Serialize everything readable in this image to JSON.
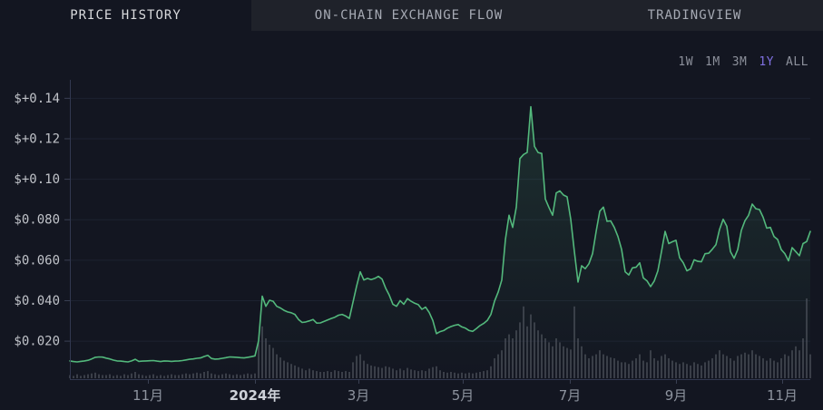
{
  "tabs": [
    {
      "label": "PRICE HISTORY",
      "active": true
    },
    {
      "label": "ON-CHAIN EXCHANGE FLOW",
      "active": false
    },
    {
      "label": "TRADINGVIEW",
      "active": false
    }
  ],
  "ranges": [
    {
      "label": "1W",
      "active": false
    },
    {
      "label": "1M",
      "active": false
    },
    {
      "label": "3M",
      "active": false
    },
    {
      "label": "1Y",
      "active": true
    },
    {
      "label": "ALL",
      "active": false
    }
  ],
  "colors": {
    "background": "#131621",
    "tabbar_bg": "#1f222a",
    "line": "#53b87c",
    "area_top": "rgba(83,184,124,0.16)",
    "area_bottom": "rgba(83,184,124,0.0)",
    "grid": "#1d2231",
    "axis": "#323850",
    "tick": "#3a4053",
    "y_label": "#c0c3c9",
    "x_label": "#8d939e",
    "x_label_bold": "#ced2d9",
    "volume": "#4a4f58",
    "range_active": "#7f70e0"
  },
  "chart_data": {
    "type": "line",
    "title": "Price history, 1 year",
    "currency": "USD",
    "grid": true,
    "y_axis_range": [
      0.001,
      0.148
    ],
    "y_ticks": [
      {
        "label": "$+0.14",
        "v": 0.14
      },
      {
        "label": "$+0.12",
        "v": 0.12
      },
      {
        "label": "$+0.10",
        "v": 0.1
      },
      {
        "label": "$0.080",
        "v": 0.08
      },
      {
        "label": "$0.060",
        "v": 0.06
      },
      {
        "label": "$0.040",
        "v": 0.04
      },
      {
        "label": "$0.020",
        "v": 0.02
      }
    ],
    "x_ticks": [
      {
        "label": "11月",
        "f": 0.1054,
        "bold": false
      },
      {
        "label": "2024年",
        "f": 0.25,
        "bold": true
      },
      {
        "label": "3月",
        "f": 0.3897,
        "bold": false
      },
      {
        "label": "5月",
        "f": 0.5306,
        "bold": false
      },
      {
        "label": "7月",
        "f": 0.6752,
        "bold": false
      },
      {
        "label": "9月",
        "f": 0.8186,
        "bold": false
      },
      {
        "label": "11月",
        "f": 0.962,
        "bold": false
      }
    ],
    "series": [
      {
        "name": "price",
        "values": [
          0.01,
          0.0097,
          0.0095,
          0.0098,
          0.01,
          0.0103,
          0.011,
          0.0118,
          0.012,
          0.0119,
          0.0114,
          0.011,
          0.0104,
          0.01,
          0.0099,
          0.0097,
          0.0095,
          0.01,
          0.0108,
          0.0098,
          0.0099,
          0.01,
          0.0101,
          0.0102,
          0.0099,
          0.0097,
          0.01,
          0.0099,
          0.0098,
          0.0099,
          0.01,
          0.0102,
          0.0105,
          0.0108,
          0.011,
          0.0113,
          0.0115,
          0.0122,
          0.0128,
          0.0112,
          0.0109,
          0.011,
          0.0113,
          0.0116,
          0.012,
          0.0119,
          0.0118,
          0.0116,
          0.0115,
          0.0118,
          0.0121,
          0.0125,
          0.02,
          0.042,
          0.037,
          0.04,
          0.0395,
          0.037,
          0.0362,
          0.035,
          0.0342,
          0.0338,
          0.033,
          0.0305,
          0.029,
          0.0293,
          0.0298,
          0.0305,
          0.0287,
          0.0288,
          0.0295,
          0.0302,
          0.031,
          0.0316,
          0.0326,
          0.033,
          0.0322,
          0.031,
          0.039,
          0.047,
          0.054,
          0.05,
          0.0508,
          0.0502,
          0.0508,
          0.0518,
          0.0505,
          0.046,
          0.0425,
          0.038,
          0.037,
          0.0398,
          0.038,
          0.0408,
          0.0395,
          0.0385,
          0.0378,
          0.0355,
          0.0366,
          0.034,
          0.03,
          0.0235,
          0.0245,
          0.025,
          0.0262,
          0.027,
          0.0276,
          0.028,
          0.0268,
          0.0262,
          0.025,
          0.0246,
          0.026,
          0.0275,
          0.0285,
          0.03,
          0.033,
          0.0395,
          0.044,
          0.05,
          0.07,
          0.082,
          0.076,
          0.086,
          0.11,
          0.112,
          0.113,
          0.1356,
          0.116,
          0.113,
          0.1125,
          0.09,
          0.0858,
          0.082,
          0.093,
          0.094,
          0.092,
          0.0911,
          0.08,
          0.064,
          0.049,
          0.057,
          0.0556,
          0.058,
          0.063,
          0.074,
          0.084,
          0.086,
          0.079,
          0.0792,
          0.076,
          0.0715,
          0.0652,
          0.054,
          0.0525,
          0.056,
          0.0563,
          0.0585,
          0.051,
          0.0496,
          0.0467,
          0.0495,
          0.0545,
          0.064,
          0.074,
          0.068,
          0.0689,
          0.0696,
          0.061,
          0.0585,
          0.0545,
          0.0555,
          0.06,
          0.0592,
          0.059,
          0.063,
          0.0632,
          0.0652,
          0.0674,
          0.075,
          0.08,
          0.0765,
          0.064,
          0.0607,
          0.065,
          0.0745,
          0.0793,
          0.082,
          0.0875,
          0.0852,
          0.0848,
          0.081,
          0.0756,
          0.076,
          0.0715,
          0.07,
          0.065,
          0.063,
          0.0595,
          0.066,
          0.064,
          0.062,
          0.068,
          0.069,
          0.074
        ]
      }
    ],
    "volume_relative": [
      0.04,
      0.03,
      0.05,
      0.03,
      0.04,
      0.05,
      0.06,
      0.07,
      0.05,
      0.04,
      0.04,
      0.05,
      0.03,
      0.04,
      0.03,
      0.05,
      0.04,
      0.06,
      0.08,
      0.05,
      0.04,
      0.03,
      0.04,
      0.05,
      0.03,
      0.04,
      0.03,
      0.04,
      0.05,
      0.04,
      0.04,
      0.05,
      0.06,
      0.05,
      0.06,
      0.07,
      0.06,
      0.08,
      0.09,
      0.06,
      0.05,
      0.04,
      0.05,
      0.06,
      0.05,
      0.04,
      0.05,
      0.04,
      0.05,
      0.06,
      0.05,
      0.06,
      0.45,
      0.65,
      0.5,
      0.42,
      0.38,
      0.3,
      0.26,
      0.22,
      0.2,
      0.18,
      0.16,
      0.14,
      0.12,
      0.1,
      0.12,
      0.1,
      0.09,
      0.08,
      0.08,
      0.09,
      0.08,
      0.1,
      0.09,
      0.08,
      0.09,
      0.08,
      0.2,
      0.28,
      0.3,
      0.22,
      0.18,
      0.16,
      0.15,
      0.14,
      0.13,
      0.15,
      0.14,
      0.12,
      0.1,
      0.12,
      0.1,
      0.13,
      0.11,
      0.1,
      0.09,
      0.1,
      0.09,
      0.12,
      0.14,
      0.15,
      0.1,
      0.08,
      0.07,
      0.08,
      0.07,
      0.06,
      0.07,
      0.06,
      0.07,
      0.06,
      0.07,
      0.08,
      0.09,
      0.1,
      0.15,
      0.25,
      0.3,
      0.35,
      0.5,
      0.55,
      0.5,
      0.6,
      0.7,
      0.9,
      0.65,
      0.8,
      0.7,
      0.6,
      0.55,
      0.5,
      0.45,
      0.4,
      0.5,
      0.45,
      0.4,
      0.38,
      0.36,
      0.9,
      0.5,
      0.4,
      0.3,
      0.25,
      0.28,
      0.3,
      0.35,
      0.3,
      0.28,
      0.26,
      0.25,
      0.22,
      0.2,
      0.2,
      0.18,
      0.22,
      0.25,
      0.3,
      0.22,
      0.2,
      0.35,
      0.25,
      0.22,
      0.28,
      0.3,
      0.25,
      0.22,
      0.2,
      0.18,
      0.2,
      0.18,
      0.16,
      0.2,
      0.18,
      0.16,
      0.2,
      0.22,
      0.25,
      0.3,
      0.35,
      0.3,
      0.28,
      0.25,
      0.22,
      0.28,
      0.3,
      0.32,
      0.3,
      0.35,
      0.3,
      0.28,
      0.25,
      0.22,
      0.25,
      0.22,
      0.2,
      0.25,
      0.3,
      0.28,
      0.35,
      0.4,
      0.35,
      0.5,
      1.0,
      0.3
    ]
  }
}
